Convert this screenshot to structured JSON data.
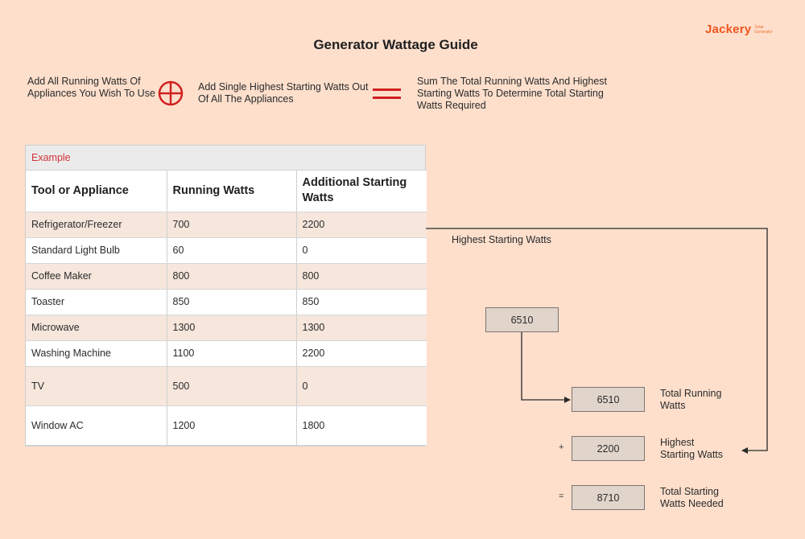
{
  "brand": {
    "name": "Jackery",
    "tagline_line1": "Solar",
    "tagline_line2": "Generator",
    "color": "#f0561f"
  },
  "title": "Generator Wattage Guide",
  "formula": {
    "step1": "Add All Running Watts Of Appliances You Wish To Use",
    "operator1_icon": "circled-plus-icon",
    "step2": "Add Single Highest Starting Watts Out Of All The Appliances",
    "operator2_icon": "equals-icon",
    "step3": "Sum The Total Running Watts And Highest Starting Watts To Determine Total Starting Watts Required",
    "accent_color": "#d0201f"
  },
  "table": {
    "caption": "Example",
    "headers": [
      "Tool or Appliance",
      "Running Watts",
      "Additional Starting Watts"
    ],
    "rows": [
      [
        "Refrigerator/Freezer",
        "700",
        "2200"
      ],
      [
        "Standard Light Bulb",
        "60",
        "0"
      ],
      [
        "Coffee Maker",
        "800",
        "800"
      ],
      [
        "Toaster",
        "850",
        "850"
      ],
      [
        "Microwave",
        "1300",
        "1300"
      ],
      [
        "Washing Machine",
        "1100",
        "2200"
      ],
      [
        "TV",
        "500",
        "0"
      ],
      [
        "Window AC",
        "1200",
        "1800"
      ]
    ]
  },
  "calculation": {
    "highest_label": "Highest Starting Watts",
    "running_sum_box": "6510",
    "total_running": {
      "value": "6510",
      "label_line1": "Total Running",
      "label_line2": "Watts"
    },
    "highest_starting": {
      "operator": "+",
      "value": "2200",
      "label_line1": "Highest",
      "label_line2": "Starting Watts"
    },
    "total_starting": {
      "operator": "=",
      "value": "8710",
      "label_line1": "Total Starting",
      "label_line2": "Watts Needed"
    }
  }
}
